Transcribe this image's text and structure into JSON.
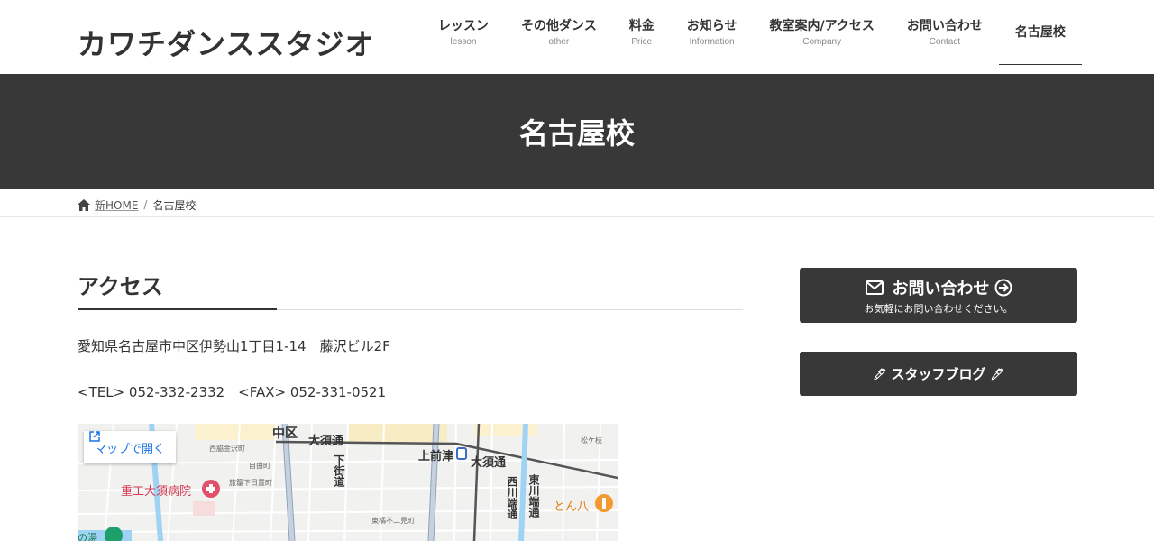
{
  "header": {
    "logo": "カワチダンススタジオ",
    "nav": [
      {
        "label": "レッスン",
        "sub": "lesson"
      },
      {
        "label": "その他ダンス",
        "sub": "other"
      },
      {
        "label": "料金",
        "sub": "Price"
      },
      {
        "label": "お知らせ",
        "sub": "Information"
      },
      {
        "label": "教室案内/アクセス",
        "sub": "Company"
      },
      {
        "label": "お問い合わせ",
        "sub": "Contact"
      },
      {
        "label": "名古屋校",
        "sub": ""
      }
    ]
  },
  "page_title": "名古屋校",
  "breadcrumb": {
    "home": "新HOME",
    "current": "名古屋校"
  },
  "main": {
    "section_title": "アクセス",
    "address": "愛知県名古屋市中区伊勢山1丁目1-14　藤沢ビル2F",
    "tel": "<TEL> 052-332-2332　<FAX> 052-331-0521",
    "map_open": "マップで開く",
    "map_labels": {
      "naka": "中区",
      "osu1": "大須通",
      "kamimaezu": "上前津",
      "osu2": "大須通",
      "jukou": "重工大須病院",
      "nishikawa": "西川端通",
      "higashikawa": "東川端通",
      "shimoyamichi": "下街道",
      "tonhachi": "とん八",
      "nishi_kanazawa": "西脇金沢町",
      "jiyu": "自由町",
      "hatago": "旅籠下日置町",
      "matsugasaka": "松ケ枝",
      "higashi": "東橘不二見町",
      "yu": "の湯"
    }
  },
  "sidebar": {
    "contact_title": "お問い合わせ",
    "contact_sub": "お気軽にお問い合わせください。",
    "blog": "スタッフブログ",
    "pen_glyph": "🖊"
  },
  "colors": {
    "dark": "#383838",
    "link_blue": "#1a73e8",
    "text": "#333333"
  }
}
